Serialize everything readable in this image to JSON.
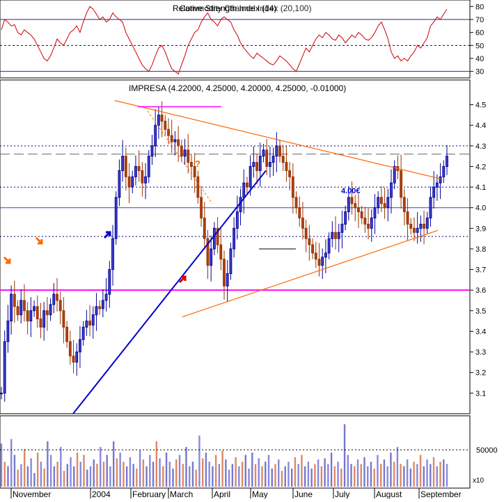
{
  "chart_data": [
    {
      "panel": "rsi",
      "type": "line",
      "title": "Relative Strength Index (14)",
      "title_overlap": "Commodity Channel Index (20,100)",
      "ylim": [
        25,
        85
      ],
      "ticks": [
        30,
        40,
        50,
        60,
        70,
        80
      ],
      "levels": [
        {
          "value": 70,
          "style": "solid"
        },
        {
          "value": 50,
          "style": "dashed"
        },
        {
          "value": 30,
          "style": "solid"
        }
      ],
      "series": [
        {
          "color": "#cc0000",
          "values": [
            62,
            70,
            68,
            65,
            66,
            60,
            58,
            62,
            60,
            58,
            55,
            50,
            45,
            40,
            38,
            42,
            48,
            55,
            52,
            50,
            55,
            60,
            62,
            65,
            60,
            68,
            75,
            80,
            78,
            74,
            70,
            72,
            68,
            70,
            75,
            72,
            70,
            68,
            60,
            55,
            50,
            45,
            40,
            35,
            32,
            30,
            35,
            42,
            48,
            50,
            45,
            38,
            32,
            30,
            28,
            35,
            42,
            50,
            55,
            60,
            62,
            68,
            72,
            75,
            70,
            68,
            65,
            70,
            72,
            70,
            68,
            62,
            58,
            52,
            48,
            45,
            42,
            40,
            44,
            42,
            40,
            38,
            36,
            35,
            38,
            42,
            40,
            38,
            35,
            32,
            30,
            36,
            42,
            48,
            45,
            50,
            55,
            58,
            56,
            60,
            58,
            55,
            54,
            58,
            56,
            52,
            55,
            58,
            56,
            60,
            58,
            55,
            54,
            56,
            60,
            65,
            68,
            62,
            55,
            45,
            40,
            42,
            38,
            40,
            38,
            42,
            45,
            50,
            48,
            52,
            56,
            65,
            68,
            72,
            70,
            74,
            78
          ]
        }
      ]
    },
    {
      "panel": "price",
      "type": "candlestick",
      "title": "IMPRESA (4.22000, 4.25000, 4.20000, 4.25000, -0.01000)",
      "ylim": [
        3.0,
        4.62
      ],
      "ticks": [
        3.1,
        3.2,
        3.3,
        3.4,
        3.5,
        3.6,
        3.7,
        3.8,
        3.9,
        4.0,
        4.1,
        4.2,
        4.3,
        4.4,
        4.5
      ],
      "x_labels": [
        "November",
        "2004",
        "February",
        "March",
        "April",
        "May",
        "June",
        "July",
        "August",
        "September"
      ],
      "closes": [
        3.1,
        3.35,
        3.45,
        3.58,
        3.52,
        3.48,
        3.55,
        3.5,
        3.45,
        3.5,
        3.52,
        3.46,
        3.42,
        3.5,
        3.48,
        3.53,
        3.58,
        3.55,
        3.5,
        3.42,
        3.35,
        3.28,
        3.25,
        3.3,
        3.36,
        3.42,
        3.45,
        3.43,
        3.48,
        3.52,
        3.51,
        3.55,
        3.58,
        3.7,
        3.85,
        4.05,
        4.18,
        4.25,
        4.15,
        4.1,
        4.15,
        4.2,
        4.18,
        4.12,
        4.15,
        4.25,
        4.3,
        4.4,
        4.45,
        4.42,
        4.38,
        4.35,
        4.32,
        4.33,
        4.3,
        4.25,
        4.28,
        4.22,
        4.2,
        4.15,
        4.05,
        3.95,
        3.85,
        3.72,
        3.8,
        3.9,
        3.82,
        3.75,
        3.62,
        3.68,
        3.8,
        3.9,
        3.98,
        4.05,
        4.12,
        4.1,
        4.2,
        4.22,
        4.18,
        4.25,
        4.28,
        4.2,
        4.22,
        4.25,
        4.3,
        4.25,
        4.22,
        4.18,
        4.15,
        4.05,
        4.0,
        3.95,
        3.9,
        3.85,
        3.82,
        3.78,
        3.75,
        3.72,
        3.76,
        3.78,
        3.85,
        3.88,
        3.85,
        3.88,
        3.92,
        3.98,
        4.05,
        4.02,
        4.0,
        3.98,
        3.95,
        3.92,
        3.9,
        3.95,
        4.0,
        4.05,
        4.02,
        4.0,
        4.05,
        4.12,
        4.2,
        4.18,
        4.05,
        3.98,
        3.92,
        3.9,
        3.88,
        3.9,
        3.92,
        3.9,
        3.95,
        4.05,
        4.1,
        4.12,
        4.15,
        4.2,
        4.25
      ],
      "volumes": [
        38,
        22,
        18,
        42,
        28,
        15,
        20,
        33,
        18,
        25,
        12,
        30,
        22,
        16,
        40,
        28,
        18,
        22,
        35,
        14,
        20,
        26,
        18,
        30,
        22,
        28,
        15,
        18,
        24,
        20,
        35,
        22,
        28,
        18,
        40,
        25,
        30,
        22,
        18,
        26,
        20,
        16,
        32,
        24,
        18,
        28,
        22,
        40,
        25,
        18,
        30,
        22,
        16,
        24,
        28,
        20,
        35,
        18,
        22,
        15,
        45,
        25,
        30,
        22,
        18,
        28,
        20,
        32,
        24,
        15,
        20,
        26,
        18,
        22,
        28,
        16,
        30,
        20,
        25,
        18,
        22,
        28,
        16,
        20,
        24,
        14,
        18,
        22,
        16,
        26,
        20,
        28,
        18,
        22,
        16,
        20,
        24,
        18,
        25,
        20,
        30,
        18,
        22,
        16,
        55,
        28,
        20,
        18,
        24,
        20,
        26,
        18,
        22,
        16,
        28,
        20,
        24,
        18,
        30,
        22,
        35,
        20,
        18,
        24,
        16,
        22,
        20,
        28,
        18,
        24,
        20,
        26,
        18,
        22,
        24,
        20
      ],
      "horizontal_levels": [
        {
          "value": 4.3,
          "style": "dotted"
        },
        {
          "value": 4.26,
          "style": "dashed"
        },
        {
          "value": 4.1,
          "style": "dotted"
        },
        {
          "value": 4.0,
          "style": "solid"
        },
        {
          "value": 3.86,
          "style": "dotted"
        },
        {
          "value": 3.6,
          "style": "magenta"
        }
      ],
      "annotations": [
        {
          "text": "4.00€",
          "color": "#0000cc"
        },
        {
          "text": "?",
          "color": "#ff6600"
        }
      ]
    },
    {
      "panel": "volume",
      "type": "bar",
      "ticks_label": [
        "50000"
      ],
      "scale_label": "x10"
    }
  ]
}
